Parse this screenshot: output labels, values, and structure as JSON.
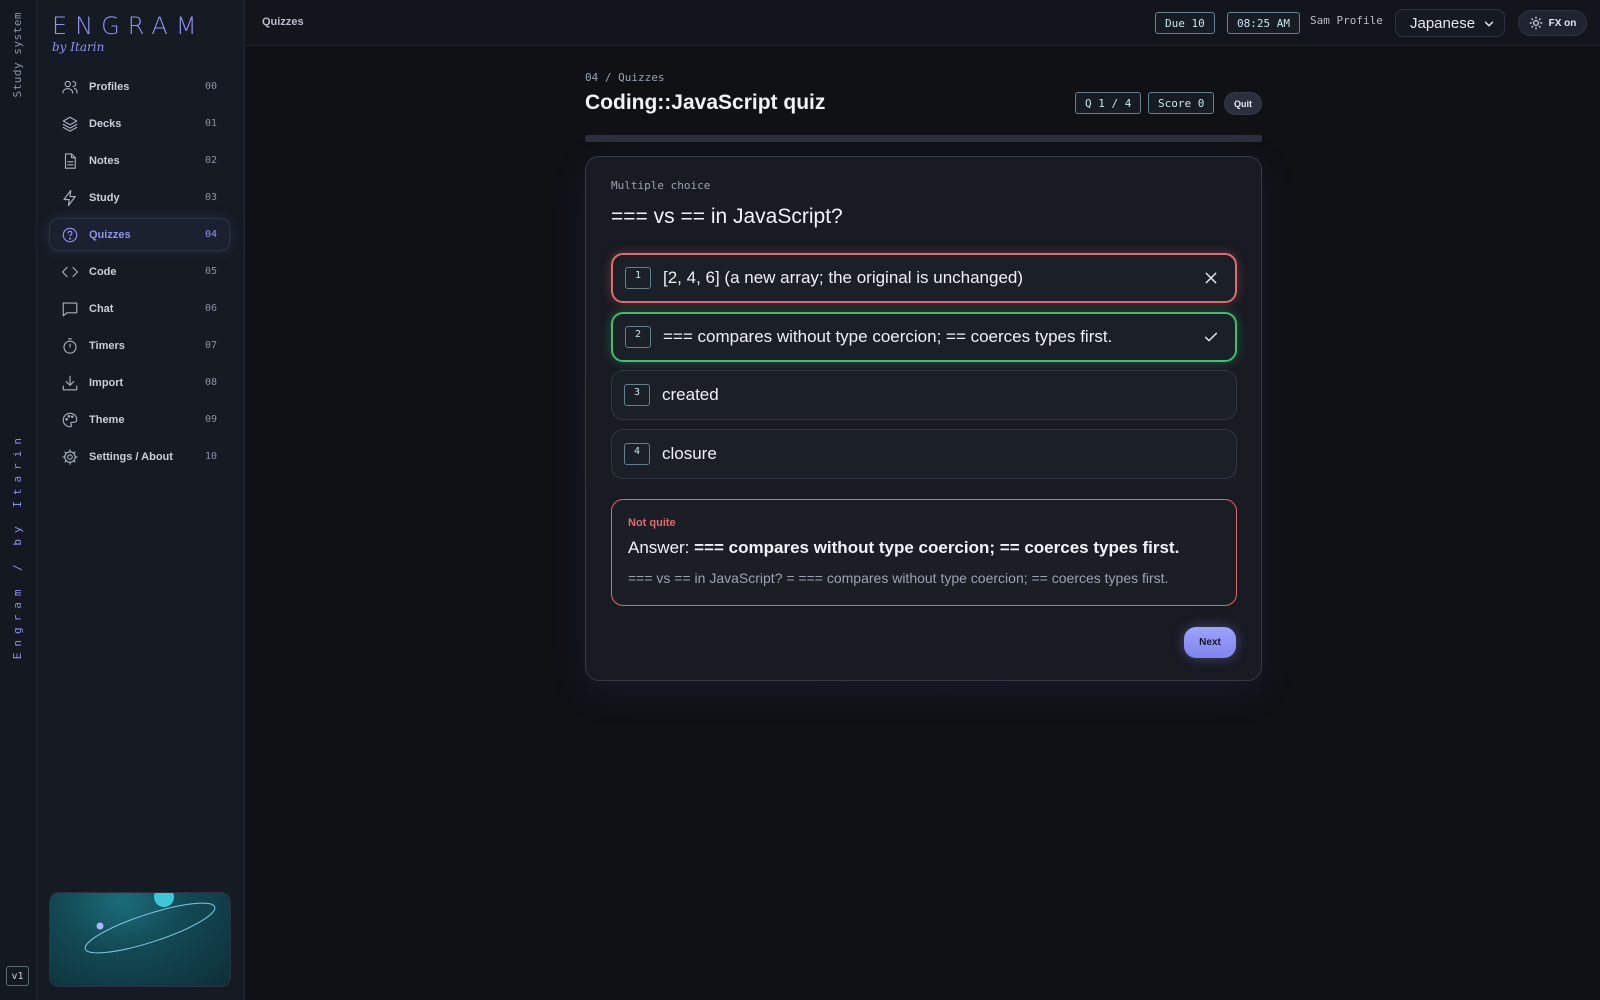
{
  "rail": {
    "top_label": "Study system",
    "vertical_label": "Engram / by Itarin",
    "version": "v1"
  },
  "brand": {
    "name": "ENGRAM",
    "byline": "by Itarin",
    "accent": "#8f93f5"
  },
  "sidebar": {
    "items": [
      {
        "label": "Profiles",
        "num": "00",
        "icon": "users-icon"
      },
      {
        "label": "Decks",
        "num": "01",
        "icon": "layers-icon"
      },
      {
        "label": "Notes",
        "num": "02",
        "icon": "file-icon"
      },
      {
        "label": "Study",
        "num": "03",
        "icon": "bolt-icon"
      },
      {
        "label": "Quizzes",
        "num": "04",
        "icon": "help-circle-icon",
        "active": true
      },
      {
        "label": "Code",
        "num": "05",
        "icon": "code-icon"
      },
      {
        "label": "Chat",
        "num": "06",
        "icon": "chat-icon"
      },
      {
        "label": "Timers",
        "num": "07",
        "icon": "timer-icon"
      },
      {
        "label": "Import",
        "num": "08",
        "icon": "download-icon"
      },
      {
        "label": "Theme",
        "num": "09",
        "icon": "palette-icon"
      },
      {
        "label": "Settings / About",
        "num": "10",
        "icon": "gear-icon"
      }
    ]
  },
  "topbar": {
    "section": "Quizzes",
    "due": "Due 10",
    "time": "08:25 AM",
    "profile": "Sam Profile",
    "language": "Japanese",
    "fx": "FX on"
  },
  "quiz": {
    "path": "04 / Quizzes",
    "title": "Coding::JavaScript quiz",
    "counter": "Q 1 / 4",
    "score": "Score 0",
    "quit": "Quit",
    "progress": 0.0,
    "question_type": "Multiple choice",
    "question": "=== vs == in JavaScript?",
    "options": [
      {
        "key": "1",
        "text": "[2, 4, 6] (a new array; the original is unchanged)",
        "state": "wrong"
      },
      {
        "key": "2",
        "text": "=== compares without type coercion; == coerces types first.",
        "state": "correct"
      },
      {
        "key": "3",
        "text": "created",
        "state": "neutral"
      },
      {
        "key": "4",
        "text": "closure",
        "state": "neutral"
      }
    ],
    "feedback": {
      "title": "Not quite",
      "answer_prefix": "Answer:",
      "answer": "=== compares without type coercion; == coerces types first.",
      "explanation": "=== vs == in JavaScript? = === compares without type coercion; == coerces types first."
    },
    "next": "Next"
  },
  "colors": {
    "wrong": "#e06a6e",
    "correct": "#3fbf6e",
    "chip_border": "#63808c"
  }
}
